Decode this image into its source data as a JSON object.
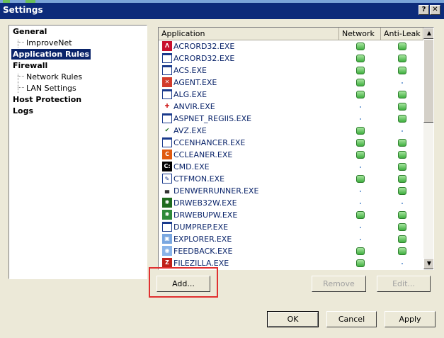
{
  "window": {
    "title": "Settings",
    "help_glyph": "?",
    "close_glyph": "✕"
  },
  "tree": {
    "items": [
      {
        "label": "General",
        "level": 0,
        "bold": true,
        "selected": false
      },
      {
        "label": "ImproveNet",
        "level": 1,
        "bold": false,
        "selected": false
      },
      {
        "label": "Application Rules",
        "level": 0,
        "bold": true,
        "selected": true
      },
      {
        "label": "Firewall",
        "level": 0,
        "bold": true,
        "selected": false
      },
      {
        "label": "Network Rules",
        "level": 1,
        "bold": false,
        "selected": false
      },
      {
        "label": "LAN Settings",
        "level": 1,
        "bold": false,
        "selected": false
      },
      {
        "label": "Host Protection",
        "level": 0,
        "bold": true,
        "selected": false
      },
      {
        "label": "Logs",
        "level": 0,
        "bold": true,
        "selected": false
      }
    ]
  },
  "list": {
    "columns": {
      "application": "Application",
      "network": "Network",
      "antileak": "Anti-Leak"
    },
    "rows": [
      {
        "name": "ACRORD32.EXE",
        "icon": "acrobat-icon",
        "network": true,
        "antileak": true
      },
      {
        "name": "ACRORD32.EXE",
        "icon": "window-icon",
        "network": true,
        "antileak": true
      },
      {
        "name": "ACS.EXE",
        "icon": "window-icon",
        "network": true,
        "antileak": true
      },
      {
        "name": "AGENT.EXE",
        "icon": "shield-icon",
        "network": true,
        "antileak": false
      },
      {
        "name": "ALG.EXE",
        "icon": "window-icon",
        "network": true,
        "antileak": true
      },
      {
        "name": "ANVIR.EXE",
        "icon": "medical-cross-icon",
        "network": false,
        "antileak": true
      },
      {
        "name": "ASPNET_REGIIS.EXE",
        "icon": "window-icon",
        "network": false,
        "antileak": true
      },
      {
        "name": "AVZ.EXE",
        "icon": "checkmark-icon",
        "network": true,
        "antileak": false
      },
      {
        "name": "CCENHANCER.EXE",
        "icon": "window-icon",
        "network": true,
        "antileak": true
      },
      {
        "name": "CCLEANER.EXE",
        "icon": "ccleaner-icon",
        "network": true,
        "antileak": true
      },
      {
        "name": "CMD.EXE",
        "icon": "console-icon",
        "network": false,
        "antileak": true
      },
      {
        "name": "CTFMON.EXE",
        "icon": "pen-icon",
        "network": true,
        "antileak": true
      },
      {
        "name": "DENWERRUNNER.EXE",
        "icon": "hat-icon",
        "network": false,
        "antileak": true
      },
      {
        "name": "DRWEB32W.EXE",
        "icon": "spider-icon",
        "network": false,
        "antileak": false
      },
      {
        "name": "DRWEBUPW.EXE",
        "icon": "globe-spider-icon",
        "network": true,
        "antileak": true
      },
      {
        "name": "DUMPREP.EXE",
        "icon": "window-icon",
        "network": false,
        "antileak": true
      },
      {
        "name": "EXPLORER.EXE",
        "icon": "explorer-icon",
        "network": false,
        "antileak": true
      },
      {
        "name": "FEEDBACK.EXE",
        "icon": "feedback-icon",
        "network": true,
        "antileak": true
      },
      {
        "name": "FILEZILLA.EXE",
        "icon": "filezilla-icon",
        "network": true,
        "antileak": false
      }
    ]
  },
  "buttons": {
    "add": "Add...",
    "remove": "Remove",
    "edit": "Edit...",
    "ok": "OK",
    "cancel": "Cancel",
    "apply": "Apply"
  },
  "scrollbar": {
    "up_glyph": "▲",
    "down_glyph": "▼"
  },
  "colors": {
    "title_bar": "#0c2a7a",
    "selection": "#0a246a",
    "indicator_on": "#3fae3f",
    "highlight_box": "#e03030"
  }
}
